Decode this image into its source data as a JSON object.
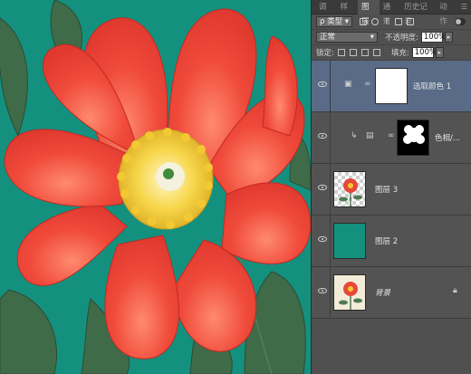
{
  "panel_tabs": [
    "调整",
    "样式",
    "图层",
    "通道",
    "历史记录",
    "动作"
  ],
  "active_tab": "图层",
  "panel_menu_icon": "panel-menu-icon",
  "filter": {
    "kind_label": "ρ 类型",
    "icons": [
      "pixel-filter-icon",
      "adjustment-filter-icon",
      "type-filter-icon",
      "shape-filter-icon",
      "smart-object-filter-icon"
    ]
  },
  "blend": {
    "mode": "正常",
    "opacity_label": "不透明度:",
    "opacity_value": "100%"
  },
  "lock": {
    "label": "锁定:",
    "fill_label": "填充:",
    "fill_value": "100%"
  },
  "layers": [
    {
      "name": "选取颜色 1",
      "selected": true
    },
    {
      "name": "色相/..."
    },
    {
      "name": "图层 3"
    },
    {
      "name": "图层 2"
    },
    {
      "name": "背景"
    }
  ],
  "colors": {
    "canvas_bg": "#14907f",
    "petal": "#f2483a",
    "selected_layer": "#596b87"
  }
}
